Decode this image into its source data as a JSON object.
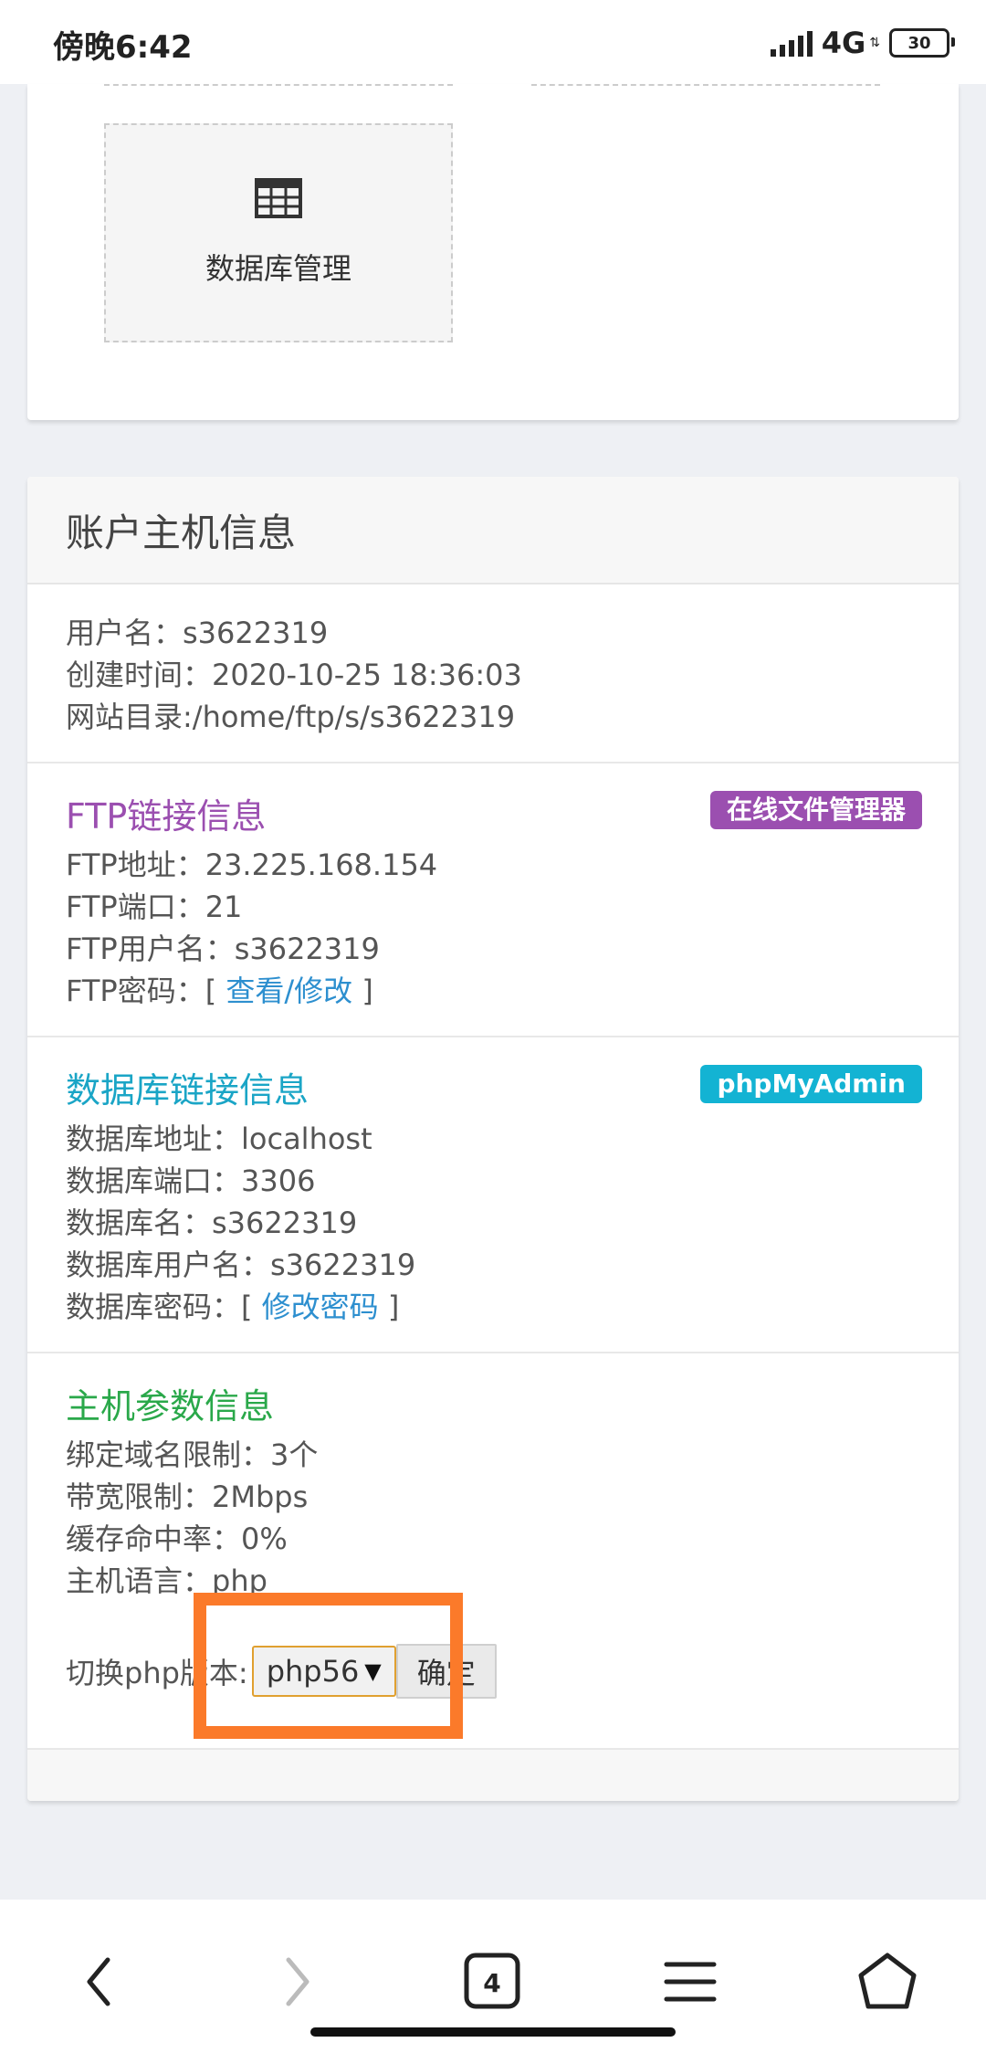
{
  "status_bar": {
    "time": "傍晚6:42",
    "network": "4G",
    "battery": "30"
  },
  "tools": {
    "database_tile_label": "数据库管理"
  },
  "account": {
    "header": "账户主机信息",
    "basic": {
      "username": "用户名：s3622319",
      "created": "创建时间：2020-10-25 18:36:03",
      "site_dir": "网站目录:/home/ftp/s/s3622319"
    },
    "ftp": {
      "title": "FTP链接信息",
      "badge": "在线文件管理器",
      "address": "FTP地址：23.225.168.154",
      "port": "FTP端口：21",
      "user": "FTP用户名：s3622319",
      "password_label": "FTP密码：",
      "password_link": "查看/修改",
      "bracket_open": "[ ",
      "bracket_close": " ]"
    },
    "db": {
      "title": "数据库链接信息",
      "badge": "phpMyAdmin",
      "address": "数据库地址：localhost",
      "port": "数据库端口：3306",
      "name": "数据库名：s3622319",
      "user": "数据库用户名：s3622319",
      "password_label": "数据库密码：",
      "password_link": "修改密码",
      "bracket_open": "[ ",
      "bracket_close": " ]"
    },
    "host": {
      "title": "主机参数信息",
      "domains": "绑定域名限制：3个",
      "bandwidth": "带宽限制：2Mbps",
      "cache": "缓存命中率：0%",
      "language": "主机语言：php",
      "switch_label": "切换php版本:",
      "php_version": "php56",
      "confirm": "确定"
    }
  },
  "colors": {
    "ftp_accent": "#9b4fb0",
    "db_accent": "#13b3d3",
    "host_accent": "#2aa84a",
    "link": "#2d8fcf",
    "highlight": "#fb7a2a"
  },
  "icons": [
    "signal-icon",
    "battery-icon",
    "table-grid-icon",
    "back-icon",
    "forward-icon",
    "tabs-icon",
    "menu-icon",
    "home-icon"
  ]
}
